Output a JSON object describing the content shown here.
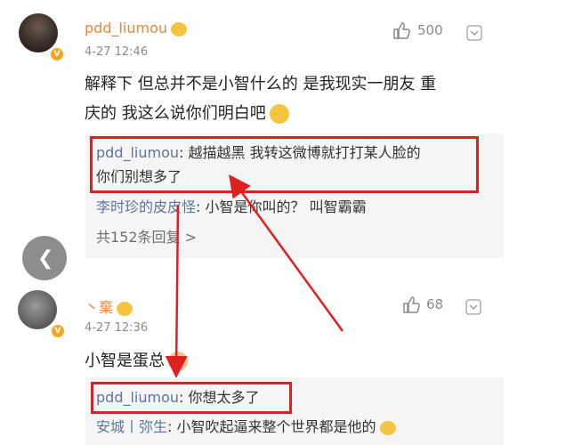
{
  "comments": [
    {
      "username": "pdd_liumou",
      "timestamp": "4-27 12:46",
      "likes": "500",
      "text_line1": "解释下 但总并不是小智什么的 是我现实一朋友 重",
      "text_line2": "庆的 我这么说你们明白吧",
      "replies": [
        {
          "user": "pdd_liumou",
          "text_line1": ": 越描越黑 我转这微博就打打某人脸的",
          "text_line2": "你们别想多了"
        },
        {
          "user": "李时珍的皮皮怪",
          "text_line1": ": 小智是你叫的？ 叫智霸霸"
        }
      ],
      "more_replies": "共152条回复 >"
    },
    {
      "username": "丶棄",
      "timestamp": "4-27 12:36",
      "likes": "68",
      "text_line1": "小智是蛋总",
      "replies": [
        {
          "user": "pdd_liumou",
          "text_line1": ": 你想太多了"
        },
        {
          "user": "安城丨弥生",
          "text_line1": ": 小智吹起逼来整个世界都是他的"
        }
      ]
    }
  ],
  "colors": {
    "username": "#e9873f",
    "reply_user": "#5b76a0",
    "highlight": "#e02020"
  },
  "icons": {
    "like": "thumbs-up-icon",
    "menu": "chevron-down-icon",
    "back": "chevron-left-icon",
    "verified": "verified-v-icon"
  }
}
